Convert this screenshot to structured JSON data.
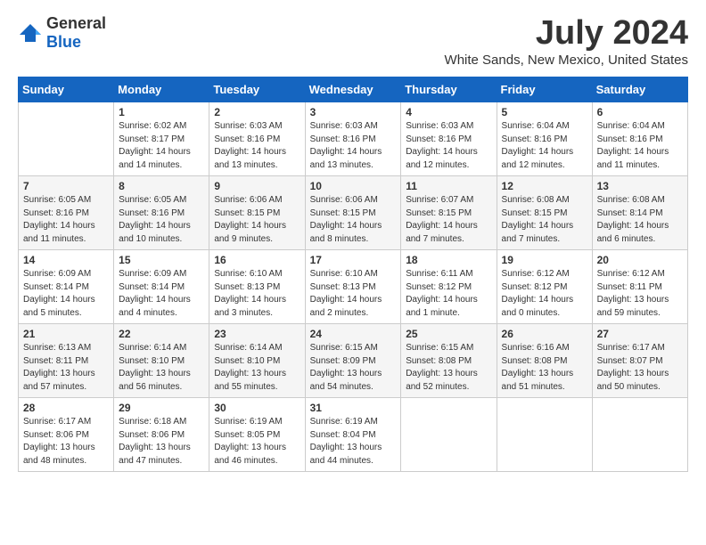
{
  "header": {
    "logo_general": "General",
    "logo_blue": "Blue",
    "title": "July 2024",
    "subtitle": "White Sands, New Mexico, United States"
  },
  "calendar": {
    "days_of_week": [
      "Sunday",
      "Monday",
      "Tuesday",
      "Wednesday",
      "Thursday",
      "Friday",
      "Saturday"
    ],
    "weeks": [
      [
        {
          "day": "",
          "info": ""
        },
        {
          "day": "1",
          "info": "Sunrise: 6:02 AM\nSunset: 8:17 PM\nDaylight: 14 hours\nand 14 minutes."
        },
        {
          "day": "2",
          "info": "Sunrise: 6:03 AM\nSunset: 8:16 PM\nDaylight: 14 hours\nand 13 minutes."
        },
        {
          "day": "3",
          "info": "Sunrise: 6:03 AM\nSunset: 8:16 PM\nDaylight: 14 hours\nand 13 minutes."
        },
        {
          "day": "4",
          "info": "Sunrise: 6:03 AM\nSunset: 8:16 PM\nDaylight: 14 hours\nand 12 minutes."
        },
        {
          "day": "5",
          "info": "Sunrise: 6:04 AM\nSunset: 8:16 PM\nDaylight: 14 hours\nand 12 minutes."
        },
        {
          "day": "6",
          "info": "Sunrise: 6:04 AM\nSunset: 8:16 PM\nDaylight: 14 hours\nand 11 minutes."
        }
      ],
      [
        {
          "day": "7",
          "info": "Sunrise: 6:05 AM\nSunset: 8:16 PM\nDaylight: 14 hours\nand 11 minutes."
        },
        {
          "day": "8",
          "info": "Sunrise: 6:05 AM\nSunset: 8:16 PM\nDaylight: 14 hours\nand 10 minutes."
        },
        {
          "day": "9",
          "info": "Sunrise: 6:06 AM\nSunset: 8:15 PM\nDaylight: 14 hours\nand 9 minutes."
        },
        {
          "day": "10",
          "info": "Sunrise: 6:06 AM\nSunset: 8:15 PM\nDaylight: 14 hours\nand 8 minutes."
        },
        {
          "day": "11",
          "info": "Sunrise: 6:07 AM\nSunset: 8:15 PM\nDaylight: 14 hours\nand 7 minutes."
        },
        {
          "day": "12",
          "info": "Sunrise: 6:08 AM\nSunset: 8:15 PM\nDaylight: 14 hours\nand 7 minutes."
        },
        {
          "day": "13",
          "info": "Sunrise: 6:08 AM\nSunset: 8:14 PM\nDaylight: 14 hours\nand 6 minutes."
        }
      ],
      [
        {
          "day": "14",
          "info": "Sunrise: 6:09 AM\nSunset: 8:14 PM\nDaylight: 14 hours\nand 5 minutes."
        },
        {
          "day": "15",
          "info": "Sunrise: 6:09 AM\nSunset: 8:14 PM\nDaylight: 14 hours\nand 4 minutes."
        },
        {
          "day": "16",
          "info": "Sunrise: 6:10 AM\nSunset: 8:13 PM\nDaylight: 14 hours\nand 3 minutes."
        },
        {
          "day": "17",
          "info": "Sunrise: 6:10 AM\nSunset: 8:13 PM\nDaylight: 14 hours\nand 2 minutes."
        },
        {
          "day": "18",
          "info": "Sunrise: 6:11 AM\nSunset: 8:12 PM\nDaylight: 14 hours\nand 1 minute."
        },
        {
          "day": "19",
          "info": "Sunrise: 6:12 AM\nSunset: 8:12 PM\nDaylight: 14 hours\nand 0 minutes."
        },
        {
          "day": "20",
          "info": "Sunrise: 6:12 AM\nSunset: 8:11 PM\nDaylight: 13 hours\nand 59 minutes."
        }
      ],
      [
        {
          "day": "21",
          "info": "Sunrise: 6:13 AM\nSunset: 8:11 PM\nDaylight: 13 hours\nand 57 minutes."
        },
        {
          "day": "22",
          "info": "Sunrise: 6:14 AM\nSunset: 8:10 PM\nDaylight: 13 hours\nand 56 minutes."
        },
        {
          "day": "23",
          "info": "Sunrise: 6:14 AM\nSunset: 8:10 PM\nDaylight: 13 hours\nand 55 minutes."
        },
        {
          "day": "24",
          "info": "Sunrise: 6:15 AM\nSunset: 8:09 PM\nDaylight: 13 hours\nand 54 minutes."
        },
        {
          "day": "25",
          "info": "Sunrise: 6:15 AM\nSunset: 8:08 PM\nDaylight: 13 hours\nand 52 minutes."
        },
        {
          "day": "26",
          "info": "Sunrise: 6:16 AM\nSunset: 8:08 PM\nDaylight: 13 hours\nand 51 minutes."
        },
        {
          "day": "27",
          "info": "Sunrise: 6:17 AM\nSunset: 8:07 PM\nDaylight: 13 hours\nand 50 minutes."
        }
      ],
      [
        {
          "day": "28",
          "info": "Sunrise: 6:17 AM\nSunset: 8:06 PM\nDaylight: 13 hours\nand 48 minutes."
        },
        {
          "day": "29",
          "info": "Sunrise: 6:18 AM\nSunset: 8:06 PM\nDaylight: 13 hours\nand 47 minutes."
        },
        {
          "day": "30",
          "info": "Sunrise: 6:19 AM\nSunset: 8:05 PM\nDaylight: 13 hours\nand 46 minutes."
        },
        {
          "day": "31",
          "info": "Sunrise: 6:19 AM\nSunset: 8:04 PM\nDaylight: 13 hours\nand 44 minutes."
        },
        {
          "day": "",
          "info": ""
        },
        {
          "day": "",
          "info": ""
        },
        {
          "day": "",
          "info": ""
        }
      ]
    ]
  }
}
